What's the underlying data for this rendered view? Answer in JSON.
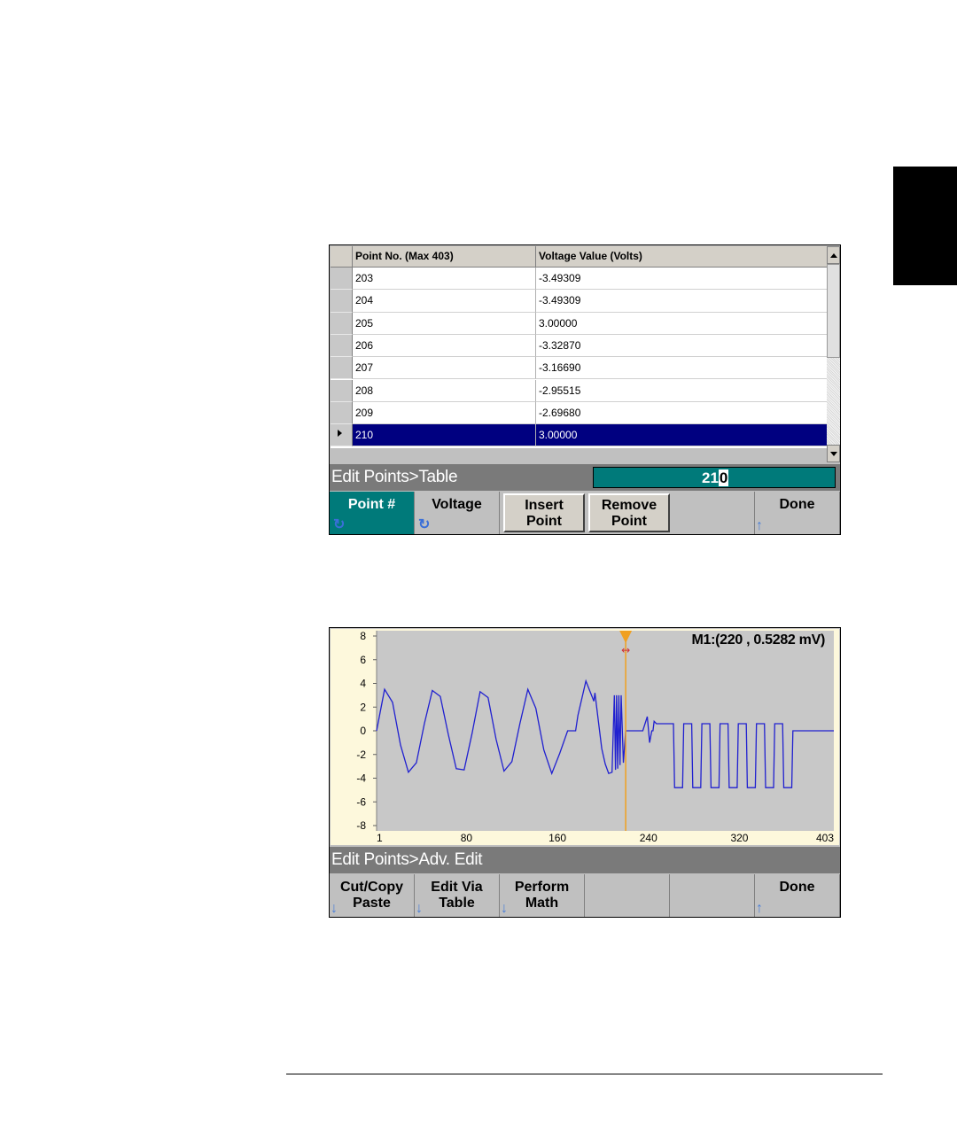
{
  "table_panel": {
    "headers": [
      "Point No. (Max 403)",
      "Voltage Value (Volts)"
    ],
    "rows": [
      {
        "point": "203",
        "voltage": "-3.49309"
      },
      {
        "point": "204",
        "voltage": "-3.49309"
      },
      {
        "point": "205",
        "voltage": "3.00000"
      },
      {
        "point": "206",
        "voltage": "-3.32870"
      },
      {
        "point": "207",
        "voltage": "-3.16690"
      },
      {
        "point": "208",
        "voltage": "-2.95515"
      },
      {
        "point": "209",
        "voltage": "-2.69680"
      },
      {
        "point": "210",
        "voltage": "3.00000"
      }
    ],
    "selected_row_index": 7,
    "status": "Edit Points>Table",
    "entry_value_prefix": "21",
    "entry_value_cursor": "0",
    "softkeys": {
      "point": "Point #",
      "voltage": "Voltage",
      "insert_line1": "Insert",
      "insert_line2": "Point",
      "remove_line1": "Remove",
      "remove_line2": "Point",
      "done": "Done"
    }
  },
  "plot_panel": {
    "marker_readout": "M1:(220 , 0.5282 mV)",
    "status": "Edit Points>Adv. Edit",
    "softkeys": {
      "cutcopy_line1": "Cut/Copy",
      "cutcopy_line2": "Paste",
      "editvia_line1": "Edit Via",
      "editvia_line2": "Table",
      "perform_line1": "Perform",
      "perform_line2": "Math",
      "done": "Done"
    }
  },
  "colors": {
    "accent_teal": "#007a7a",
    "selection_navy": "#000080",
    "waveform_blue": "#2020d0",
    "marker_orange": "#f0a020"
  },
  "chart_data": {
    "type": "line",
    "x_ticks": [
      "1",
      "80",
      "160",
      "240",
      "320",
      "403"
    ],
    "y_ticks": [
      "8",
      "6",
      "4",
      "2",
      "0",
      "-2",
      "-4",
      "-6",
      "-8"
    ],
    "xlim": [
      1,
      403
    ],
    "ylim": [
      -8,
      8
    ],
    "marker": {
      "x": 220,
      "y": 0.0005282
    },
    "series": [
      {
        "x": [
          1,
          8,
          15,
          22,
          29,
          36,
          43,
          50,
          57,
          64,
          71,
          78,
          85,
          92,
          99,
          106,
          113,
          120,
          127,
          134,
          141,
          148,
          155,
          162,
          169,
          176,
          178,
          185,
          192,
          193,
          196,
          199,
          202,
          205,
          208,
          210,
          211,
          212,
          213,
          214,
          215,
          216,
          218,
          220,
          235,
          239,
          241,
          242,
          243,
          244,
          245,
          247,
          249,
          252,
          255,
          262,
          263,
          270,
          271,
          278,
          279,
          286,
          287,
          294,
          295,
          302,
          303,
          310,
          311,
          318,
          319,
          326,
          327,
          334,
          335,
          342,
          343,
          350,
          351,
          358,
          359,
          366,
          367,
          374,
          403
        ],
        "y": [
          0,
          3.5,
          2.4,
          -1.2,
          -3.5,
          -2.7,
          0.6,
          3.4,
          2.9,
          -0.3,
          -3.2,
          -3.3,
          -0.2,
          3.3,
          2.8,
          -0.7,
          -3.4,
          -2.6,
          0.6,
          3.5,
          1.9,
          -1.6,
          -3.6,
          -1.9,
          0,
          0,
          1.3,
          4.2,
          2.5,
          3.2,
          0.8,
          -1.5,
          -2.8,
          -3.6,
          -3.5,
          3.0,
          -3.3,
          3.0,
          -3.2,
          3.0,
          -2.9,
          3.0,
          -2.7,
          0,
          0,
          1.2,
          -1.0,
          -0.5,
          0,
          0,
          0.8,
          0.6,
          0.6,
          0.6,
          0.6,
          0.6,
          -4.8,
          -4.8,
          0.6,
          0.6,
          -4.8,
          -4.8,
          0.6,
          0.6,
          -4.8,
          -4.8,
          0.6,
          0.6,
          -4.8,
          -4.8,
          0.6,
          0.6,
          -4.8,
          -4.8,
          0.6,
          0.6,
          -4.8,
          -4.8,
          0.6,
          0.6,
          -4.8,
          -4.8,
          0,
          0,
          0
        ]
      }
    ]
  }
}
